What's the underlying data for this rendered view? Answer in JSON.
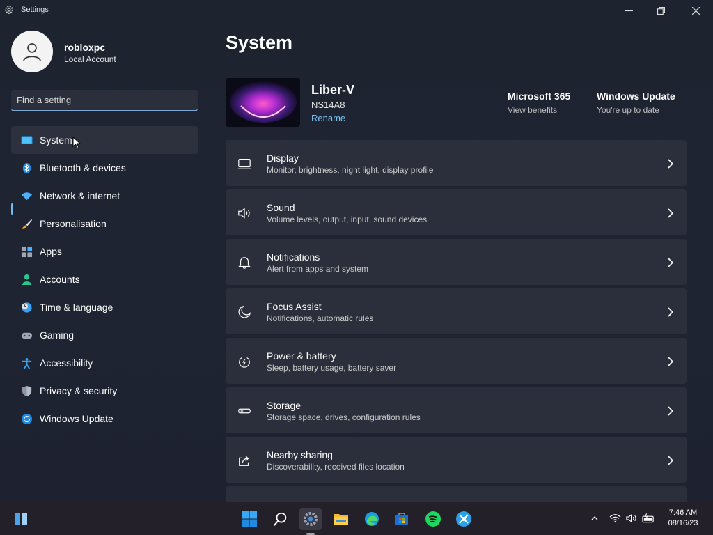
{
  "window": {
    "title": "Settings"
  },
  "user": {
    "name": "robloxpc",
    "account_type": "Local Account"
  },
  "search": {
    "placeholder": "Find a setting"
  },
  "nav": [
    {
      "label": "System",
      "icon": "system-icon",
      "active": true
    },
    {
      "label": "Bluetooth & devices",
      "icon": "bluetooth-icon"
    },
    {
      "label": "Network & internet",
      "icon": "wifi-icon"
    },
    {
      "label": "Personalisation",
      "icon": "brush-icon"
    },
    {
      "label": "Apps",
      "icon": "apps-icon"
    },
    {
      "label": "Accounts",
      "icon": "person-icon"
    },
    {
      "label": "Time & language",
      "icon": "clock-globe-icon"
    },
    {
      "label": "Gaming",
      "icon": "gamepad-icon"
    },
    {
      "label": "Accessibility",
      "icon": "accessibility-icon"
    },
    {
      "label": "Privacy & security",
      "icon": "shield-icon"
    },
    {
      "label": "Windows Update",
      "icon": "update-icon"
    }
  ],
  "main": {
    "title": "System",
    "device": {
      "name": "Liber-V",
      "model": "NS14A8",
      "rename_label": "Rename"
    },
    "quick_links": [
      {
        "title": "Microsoft 365",
        "subtitle": "View benefits"
      },
      {
        "title": "Windows Update",
        "subtitle": "You're up to date"
      }
    ],
    "cards": [
      {
        "title": "Display",
        "subtitle": "Monitor, brightness, night light, display profile",
        "icon": "display-icon"
      },
      {
        "title": "Sound",
        "subtitle": "Volume levels, output, input, sound devices",
        "icon": "speaker-icon"
      },
      {
        "title": "Notifications",
        "subtitle": "Alert from apps and system",
        "icon": "bell-icon"
      },
      {
        "title": "Focus Assist",
        "subtitle": "Notifications, automatic rules",
        "icon": "moon-icon"
      },
      {
        "title": "Power & battery",
        "subtitle": "Sleep, battery usage, battery saver",
        "icon": "power-icon"
      },
      {
        "title": "Storage",
        "subtitle": "Storage space, drives, configuration rules",
        "icon": "storage-icon"
      },
      {
        "title": "Nearby sharing",
        "subtitle": "Discoverability, received files location",
        "icon": "share-icon"
      }
    ]
  },
  "taskbar": {
    "apps": [
      "widgets-icon",
      "start-icon",
      "search-icon",
      "settings-icon",
      "file-explorer-icon",
      "edge-icon",
      "store-icon",
      "spotify-icon",
      "app-icon"
    ],
    "clock": {
      "time": "7:46 AM",
      "date": "08/16/23"
    }
  },
  "colors": {
    "accent": "#76b9ed",
    "link": "#7cc0f4",
    "card": "#2a2f3b",
    "background": "#1e2330"
  }
}
